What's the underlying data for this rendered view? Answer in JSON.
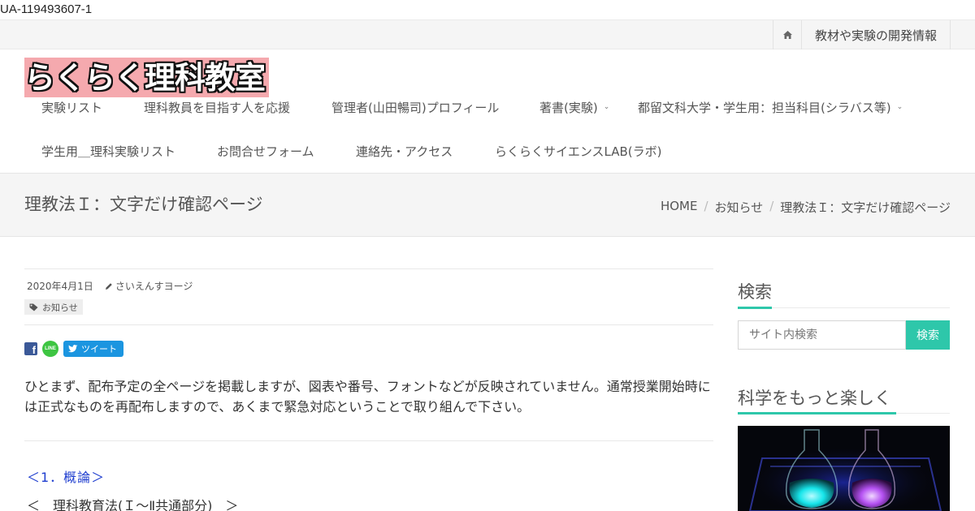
{
  "tracking_id": "UA-119493607-1",
  "topbar": {
    "home_icon": "home-icon",
    "info_link": "教材や実験の開発情報"
  },
  "logo": {
    "text": "らくらく理科教室"
  },
  "nav": {
    "items": [
      {
        "label": "実験リスト"
      },
      {
        "label": "理科教員を目指す人を応援"
      },
      {
        "label": "管理者(山田暢司)プロフィール"
      },
      {
        "label": "著書(実験)"
      },
      {
        "label": "都留文科大学・学生用：担当科目(シラバス等)"
      },
      {
        "label": "学生用＿理科実験リスト"
      },
      {
        "label": "お問合せフォーム"
      },
      {
        "label": "連絡先・アクセス"
      },
      {
        "label": "らくらくサイエンスLAB(ラボ)"
      }
    ]
  },
  "page": {
    "title": "理教法Ｉ：文字だけ確認ページ"
  },
  "breadcrumb": {
    "home": "HOME",
    "category": "お知らせ",
    "current": "理教法Ｉ：文字だけ確認ページ",
    "separator": "/"
  },
  "post": {
    "date": "2020年4月1日",
    "author": "さいえんすヨージ",
    "tag": "お知らせ",
    "share": {
      "facebook": "f",
      "line": "LINE",
      "tweet": "ツイート"
    },
    "body": "ひとまず、配布予定の全ページを掲載しますが、図表や番号、フォントなどが反映されていません。通常授業開始時には正式なものを再配布しますので、あくまで緊急対応ということで取り組んで下さい。",
    "section_heading": "＜1．概論＞",
    "section_sub": "＜　理科教育法(Ｉ～Ⅱ共通部分)　＞"
  },
  "sidebar": {
    "search": {
      "title": "検索",
      "placeholder": "サイト内検索",
      "button": "検索"
    },
    "science": {
      "title": "科学をもっと楽しく"
    }
  },
  "colors": {
    "accent": "#2ec7aa",
    "logo_bg": "#f5a9ae",
    "link_blue": "#1f3ecf",
    "tweet_blue": "#1b95e0",
    "facebook_blue": "#3b5998",
    "line_green": "#3ec542"
  }
}
